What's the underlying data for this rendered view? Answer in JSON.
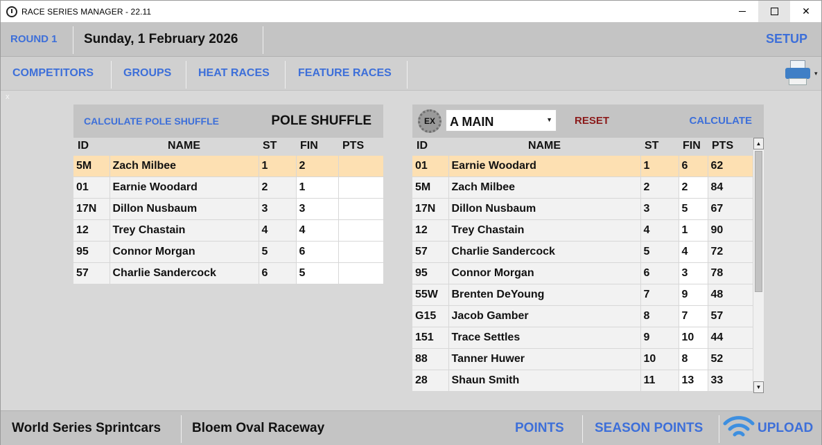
{
  "app": {
    "title": "RACE SERIES MANAGER - 22.11"
  },
  "header": {
    "round": "ROUND 1",
    "date": "Sunday, 1 February 2026",
    "setup": "SETUP"
  },
  "nav": {
    "items": [
      "COMPETITORS",
      "GROUPS",
      "HEAT RACES",
      "FEATURE RACES"
    ]
  },
  "close_hint": "x",
  "pole_panel": {
    "calculate_label": "CALCULATE POLE SHUFFLE",
    "title": "POLE SHUFFLE",
    "columns": [
      "ID",
      "NAME",
      "ST",
      "FIN",
      "PTS"
    ],
    "rows": [
      {
        "id": "5M",
        "name": "Zach Milbee",
        "st": "1",
        "fin": "2",
        "pts": ""
      },
      {
        "id": "01",
        "name": "Earnie Woodard",
        "st": "2",
        "fin": "1",
        "pts": ""
      },
      {
        "id": "17N",
        "name": "Dillon Nusbaum",
        "st": "3",
        "fin": "3",
        "pts": ""
      },
      {
        "id": "12",
        "name": "Trey Chastain",
        "st": "4",
        "fin": "4",
        "pts": ""
      },
      {
        "id": "95",
        "name": "Connor Morgan",
        "st": "5",
        "fin": "6",
        "pts": ""
      },
      {
        "id": "57",
        "name": "Charlie Sandercock",
        "st": "6",
        "fin": "5",
        "pts": ""
      }
    ]
  },
  "main_panel": {
    "gear_text": "EX",
    "race_select": "A MAIN",
    "reset_label": "RESET",
    "calculate_label": "CALCULATE",
    "columns": [
      "ID",
      "NAME",
      "ST",
      "FIN",
      "PTS"
    ],
    "rows": [
      {
        "id": "01",
        "name": "Earnie Woodard",
        "st": "1",
        "fin": "6",
        "pts": "62"
      },
      {
        "id": "5M",
        "name": "Zach Milbee",
        "st": "2",
        "fin": "2",
        "pts": "84"
      },
      {
        "id": "17N",
        "name": "Dillon Nusbaum",
        "st": "3",
        "fin": "5",
        "pts": "67"
      },
      {
        "id": "12",
        "name": "Trey Chastain",
        "st": "4",
        "fin": "1",
        "pts": "90"
      },
      {
        "id": "57",
        "name": "Charlie Sandercock",
        "st": "5",
        "fin": "4",
        "pts": "72"
      },
      {
        "id": "95",
        "name": "Connor Morgan",
        "st": "6",
        "fin": "3",
        "pts": "78"
      },
      {
        "id": "55W",
        "name": "Brenten DeYoung",
        "st": "7",
        "fin": "9",
        "pts": "48"
      },
      {
        "id": "G15",
        "name": "Jacob Gamber",
        "st": "8",
        "fin": "7",
        "pts": "57"
      },
      {
        "id": "151",
        "name": "Trace Settles",
        "st": "9",
        "fin": "10",
        "pts": "44"
      },
      {
        "id": "88",
        "name": "Tanner Huwer",
        "st": "10",
        "fin": "8",
        "pts": "52"
      },
      {
        "id": "28",
        "name": "Shaun Smith",
        "st": "11",
        "fin": "13",
        "pts": "33"
      }
    ]
  },
  "footer": {
    "series": "World Series Sprintcars",
    "venue": "Bloem Oval Raceway",
    "points": "POINTS",
    "season_points": "SEASON POINTS",
    "upload": "UPLOAD"
  },
  "colors": {
    "accent": "#3d6fd9",
    "selected_row": "#fde0b2",
    "reset": "#8b1a1a"
  }
}
